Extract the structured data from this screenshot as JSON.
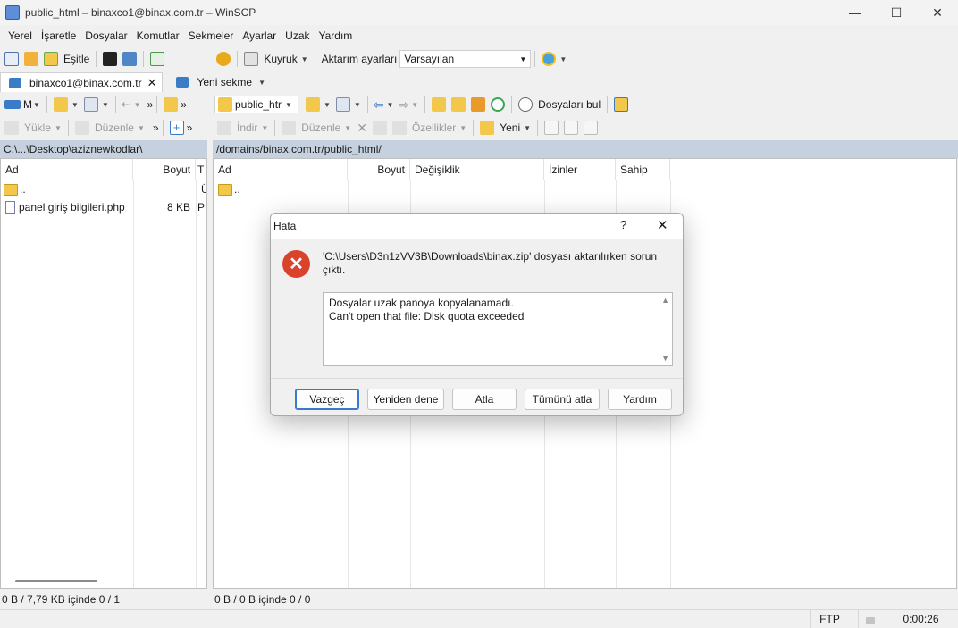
{
  "window": {
    "title": "public_html – binaxco1@binax.com.tr – WinSCP",
    "minimize": "—",
    "maximize": "☐",
    "close": "✕"
  },
  "menu": [
    "Yerel",
    "İşaretle",
    "Dosyalar",
    "Komutlar",
    "Sekmeler",
    "Ayarlar",
    "Uzak",
    "Yardım"
  ],
  "toolbar": {
    "sync_label": "Eşitle",
    "queue_label": "Kuyruk",
    "transfer_settings_label": "Aktarım ayarları",
    "transfer_preset": "Varsayılan"
  },
  "tabs": {
    "session": "binaxco1@binax.com.tr",
    "new_tab": "Yeni sekme"
  },
  "local_toolbar": {
    "drive": "M",
    "upload": "Yükle",
    "edit": "Düzenle"
  },
  "remote_toolbar": {
    "folder": "public_htr",
    "find_files": "Dosyaları bul",
    "download": "İndir",
    "edit": "Düzenle",
    "properties": "Özellikler",
    "new": "Yeni"
  },
  "local_panel": {
    "path": "C:\\...\\Desktop\\aziznewkodlar\\",
    "columns": [
      "Ad",
      "Boyut",
      "T"
    ],
    "rows": [
      {
        "name": "..",
        "size": "",
        "type": "Ü"
      },
      {
        "name": "panel giriş bilgileri.php",
        "size": "8 KB",
        "type": "P"
      }
    ],
    "status": "0 B / 7,79 KB içinde 0 / 1"
  },
  "remote_panel": {
    "path": "/domains/binax.com.tr/public_html/",
    "columns": [
      "Ad",
      "Boyut",
      "Değişiklik",
      "İzinler",
      "Sahip"
    ],
    "rows": [
      {
        "name": ".."
      }
    ],
    "status": "0 B / 0 B içinde 0 / 0"
  },
  "statusbar": {
    "protocol": "FTP",
    "elapsed": "0:00:26"
  },
  "dialog": {
    "title": "Hata",
    "help_glyph": "?",
    "close_glyph": "✕",
    "message": "'C:\\Users\\D3n1zVV3B\\Downloads\\binax.zip' dosyası aktarılırken sorun çıktı.",
    "details_line1": "Dosyalar uzak panoya kopyalanamadı.",
    "details_line2": "Can't open that file: Disk quota exceeded",
    "buttons": {
      "cancel": "Vazgeç",
      "retry": "Yeniden dene",
      "skip": "Atla",
      "skip_all": "Tümünü atla",
      "help": "Yardım"
    }
  },
  "colors": {
    "path_bar": "#c6d1e0",
    "error_red": "#d9432b",
    "folder": "#f3c84a",
    "accent_blue": "#3a78c8"
  }
}
